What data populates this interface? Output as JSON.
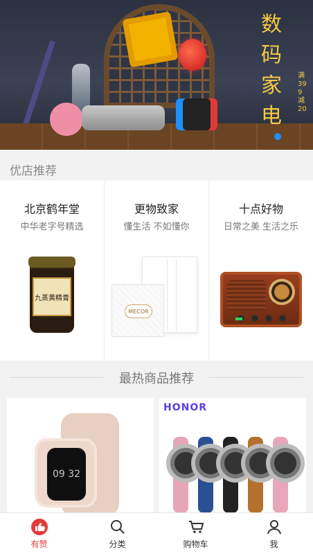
{
  "banner": {
    "caption": "数码家电",
    "tag": "满399减20",
    "active_dot_color": "#1e90ff"
  },
  "section": {
    "title": "优店推荐"
  },
  "stores": [
    {
      "name": "北京鹤年堂",
      "subtitle": "中华老字号精选",
      "product_icon": "jar-icon",
      "product_label": "九蒸黄精膏"
    },
    {
      "name": "更物致家",
      "subtitle": "懂生活 不如懂你",
      "product_icon": "gift-box-icon",
      "product_label": "MECOR"
    },
    {
      "name": "十点好物",
      "subtitle": "日常之美 生活之乐",
      "product_icon": "radio-icon"
    }
  ],
  "hot": {
    "title": "最热商品推荐",
    "items": [
      {
        "product_icon": "smartwatch-icon",
        "screen_text": "09 32"
      },
      {
        "brand": "HONOR",
        "product_icon": "watch-set-icon"
      }
    ]
  },
  "nav": {
    "items": [
      {
        "label": "有赞",
        "icon": "like-icon",
        "active": true
      },
      {
        "label": "分类",
        "icon": "search-icon",
        "active": false
      },
      {
        "label": "购物车",
        "icon": "cart-icon",
        "active": false
      },
      {
        "label": "我",
        "icon": "user-icon",
        "active": false
      }
    ],
    "active_color": "#e23c39"
  }
}
